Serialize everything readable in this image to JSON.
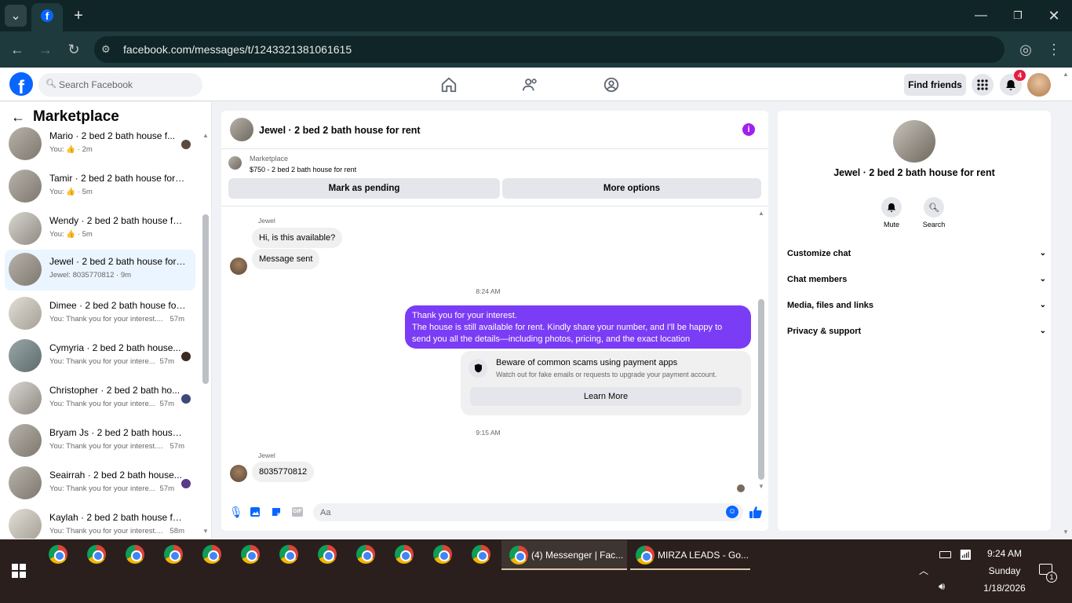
{
  "browser": {
    "tab_title": "(4) Messenger | Facebook",
    "url": "facebook.com/messages/t/1243321381061615"
  },
  "fb": {
    "search_placeholder": "Search Facebook",
    "find_friends": "Find friends",
    "notification_count": "4"
  },
  "left": {
    "title": "Marketplace",
    "conversations": [
      {
        "name": "Mario · 2 bed 2 bath house f...",
        "sub": "You: 👍 · 2m"
      },
      {
        "name": "Tamir · 2 bed 2 bath house for r...",
        "sub": "You: 👍 · 5m"
      },
      {
        "name": "Wendy · 2 bed 2 bath house for...",
        "sub": "You: 👍 · 5m"
      },
      {
        "name": "Jewel · 2 bed 2 bath house for r...",
        "sub": "Jewel: 8035770812 · 9m"
      },
      {
        "name": "Dimee · 2 bed 2 bath house for ...",
        "sub": "You: Thank you for your interest....",
        "time": "57m"
      },
      {
        "name": "Cymyria · 2 bed 2 bath house...",
        "sub": "You: Thank you for your intere...",
        "time": "57m"
      },
      {
        "name": "Christopher · 2 bed 2 bath ho...",
        "sub": "You: Thank you for your intere...",
        "time": "57m"
      },
      {
        "name": "Bryam Js · 2 bed 2 bath house f...",
        "sub": "You: Thank you for your interest....",
        "time": "57m"
      },
      {
        "name": "Seairrah · 2 bed 2 bath house...",
        "sub": "You: Thank you for your intere...",
        "time": "57m"
      },
      {
        "name": "Kaylah · 2 bed 2 bath house for...",
        "sub": "You: Thank you for your interest....",
        "time": "58m"
      }
    ]
  },
  "chat": {
    "title": "Jewel · 2 bed 2 bath house for rent",
    "listing_label": "Marketplace",
    "listing_price": "$750 - 2 bed 2 bath house for rent",
    "mark_pending": "Mark as pending",
    "more_options": "More options",
    "sender1": "Jewel",
    "msg1": "Hi, is this available?",
    "msg2": "Message sent",
    "time1": "8:24 AM",
    "out_line1": "Thank you for your interest.",
    "out_line2": "The house is still available for rent. Kindly share your number, and I'll be happy to",
    "out_line3": "send you all the details—including photos, pricing, and the exact location",
    "scam_title": "Beware of common scams using payment apps",
    "scam_sub": "Watch out for fake emails or requests to upgrade your payment account.",
    "learn_more": "Learn More",
    "time2": "9:15 AM",
    "sender2": "Jewel",
    "msg3": "8035770812",
    "composer_placeholder": "Aa"
  },
  "right": {
    "title": "Jewel · 2 bed 2 bath house for rent",
    "mute": "Mute",
    "search": "Search",
    "rows": [
      "Customize chat",
      "Chat members",
      "Media, files and links",
      "Privacy & support"
    ]
  },
  "taskbar": {
    "app1": "(4) Messenger | Fac...",
    "app2": "MIRZA LEADS - Go...",
    "time": "9:24 AM",
    "day": "Sunday",
    "date": "1/18/2026",
    "notif_count": "1"
  }
}
